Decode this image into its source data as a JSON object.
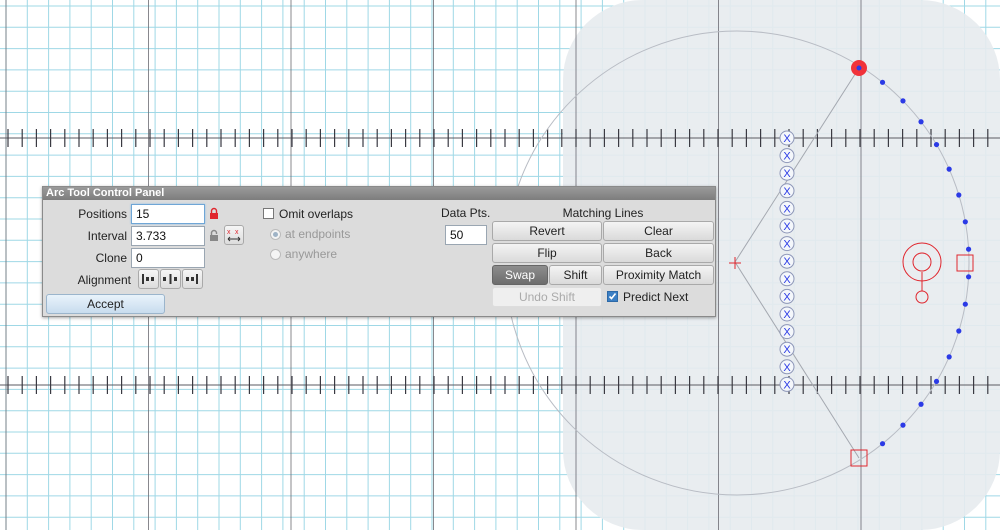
{
  "panel": {
    "title": "Arc Tool Control Panel",
    "positions_label": "Positions",
    "positions_value": "15",
    "interval_label": "Interval",
    "interval_value": "3.733",
    "clone_label": "Clone",
    "clone_value": "0",
    "alignment_label": "Alignment",
    "accept_label": "Accept",
    "omit_overlaps_label": "Omit overlaps",
    "omit_overlaps_checked": false,
    "at_endpoints_label": "at endpoints",
    "anywhere_label": "anywhere",
    "data_pts_label": "Data Pts.",
    "data_pts_value": "50",
    "matching_lines_label": "Matching Lines",
    "revert_label": "Revert",
    "clear_label": "Clear",
    "flip_label": "Flip",
    "back_label": "Back",
    "swap_label": "Swap",
    "shift_label": "Shift",
    "proximity_match_label": "Proximity Match",
    "undo_shift_label": "Undo Shift",
    "predict_next_label": "Predict Next",
    "predict_next_checked": true,
    "x_marker_glyph": "X"
  },
  "colors": {
    "grid_minor": "#9fd8e6",
    "grid_major": "#6b6b73",
    "accent_red": "#e0262e",
    "accent_blue": "#2b3ae6",
    "halo_fill": "#e7ebee"
  }
}
